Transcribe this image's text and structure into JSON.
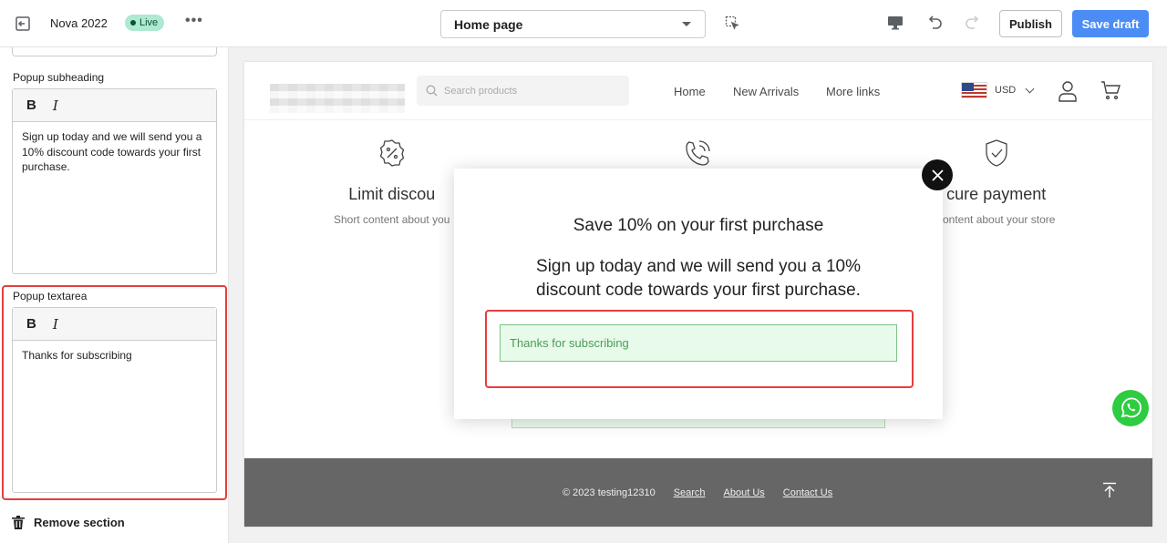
{
  "topbar": {
    "theme_name": "Nova 2022",
    "live_badge": "Live",
    "more_label": "•••",
    "page_select": "Home page",
    "publish_label": "Publish",
    "save_draft_label": "Save draft",
    "save_color": "#4b8cf5"
  },
  "sidebar": {
    "subheading_label": "Popup subheading",
    "subheading_text": "Sign up today and we will send you a 10% discount code towards your first purchase.",
    "textarea_label": "Popup textarea",
    "textarea_text": "Thanks for subscribing",
    "bold_label": "B",
    "italic_label": "I",
    "remove_section_label": "Remove section"
  },
  "store": {
    "search_placeholder": "Search products",
    "nav": [
      "Home",
      "New Arrivals",
      "More links"
    ],
    "currency": "USD",
    "features": [
      {
        "icon": "discount-badge-icon",
        "title": "Limit discount",
        "subtitle": "Short content about your store"
      },
      {
        "icon": "phone-call-icon",
        "title": "",
        "subtitle": ""
      },
      {
        "icon": "shield-check-icon",
        "title": "Secure payment",
        "subtitle": "Short content about your store"
      }
    ],
    "feature_title_visible_0": "Limit discou",
    "feature_sub_visible_0": "Short content about you",
    "feature_title_visible_2": "cure payment",
    "feature_sub_visible_2": "content about your store",
    "footer": {
      "copyright": "© 2023 testing12310",
      "links": [
        "Search",
        "About Us",
        "Contact Us"
      ]
    }
  },
  "popup": {
    "heading": "Save 10% on your first purchase",
    "subheading": "Sign up today and we will send you a 10% discount code towards your first purchase.",
    "field_text": "Thanks for subscribing"
  },
  "colors": {
    "highlight": "#e53e3e",
    "success_bg": "#e8faea",
    "success_border": "#7cc687",
    "footer_bg": "#666666",
    "whatsapp": "#2ecc40"
  }
}
